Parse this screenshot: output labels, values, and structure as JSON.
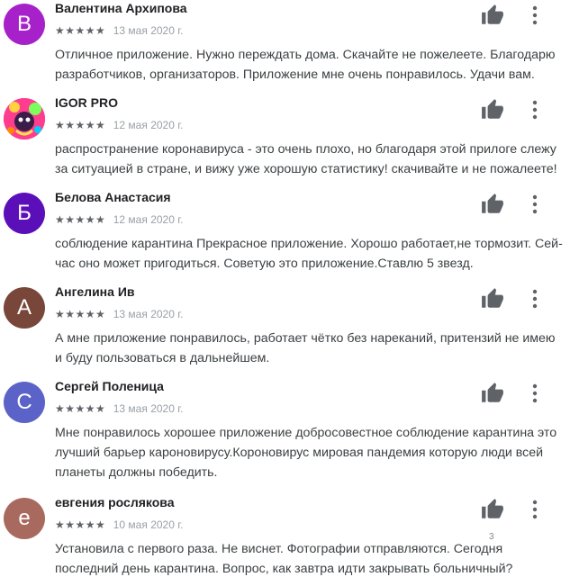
{
  "reviews": [
    {
      "avatar_letter": "В",
      "avatar_color": "#a621c9",
      "author": "Валентина Архипова",
      "stars": "★★★★★",
      "rating": 5,
      "date": "13 мая 2020 г.",
      "text": "Отличное приложение. Нужно переждать дома. Скачайте не пожелеете. Благодарю разработчиков, организаторов. Приложение мне очень понравилось. Удачи вам."
    },
    {
      "avatar_letter": "",
      "avatar_color": "#ff2e88",
      "avatar_icon": "photo-avatar-icon",
      "author": "IGOR PRO",
      "stars": "★★★★★",
      "rating": 5,
      "date": "12 мая 2020 г.",
      "text": "распространение коронавируса - это очень плохо, но благодаря этой прилоге слежу за ситуацией в стране, и вижу уже хорошую статистику! скачивайте и не пожалеете!"
    },
    {
      "avatar_letter": "Б",
      "avatar_color": "#5b0fb8",
      "author": "Белова Анастасия",
      "stars": "★★★★★",
      "rating": 5,
      "date": "12 мая 2020 г.",
      "text": "соблюдение карантина Прекрасное приложение. Хорошо работает,не тормозит. Сей- час оно может пригодиться. Советую это приложение.Ставлю 5 звезд."
    },
    {
      "avatar_letter": "А",
      "avatar_color": "#79463a",
      "author": "Ангелина Ив",
      "stars": "★★★★★",
      "rating": 5,
      "date": "13 мая 2020 г.",
      "text": "А мне приложение понравилось, работает чётко без нареканий, притензий не имею и буду пользоваться в дальнейшем."
    },
    {
      "avatar_letter": "С",
      "avatar_color": "#5b63c8",
      "author": "Сергей Поленица",
      "stars": "★★★★★",
      "rating": 5,
      "date": "13 мая 2020 г.",
      "text": "Мне понравилось хорошее приложение добросовестное соблюдение карантина это лучший барьер кароновирусу.Короновирус мировая пандемия которую люди всей планеты должны победить."
    },
    {
      "avatar_letter": "е",
      "avatar_color": "#a86a5f",
      "author": "евгения рослякова",
      "stars": "★★★★★",
      "rating": 5,
      "date": "10 мая 2020 г.",
      "helpful_count": "3",
      "text": "Установила с первого раза. Не виснет. Фотографии отправляются. Сегодня последний день карантина. Вопрос, как завтра идти закрывать больничный?"
    }
  ],
  "icons": {
    "helpful": "thumbs-up-icon",
    "menu": "more-vert-icon"
  },
  "colors": {
    "icon": "#5f6368",
    "text": "#3c4043",
    "date": "#9aa0a6"
  }
}
